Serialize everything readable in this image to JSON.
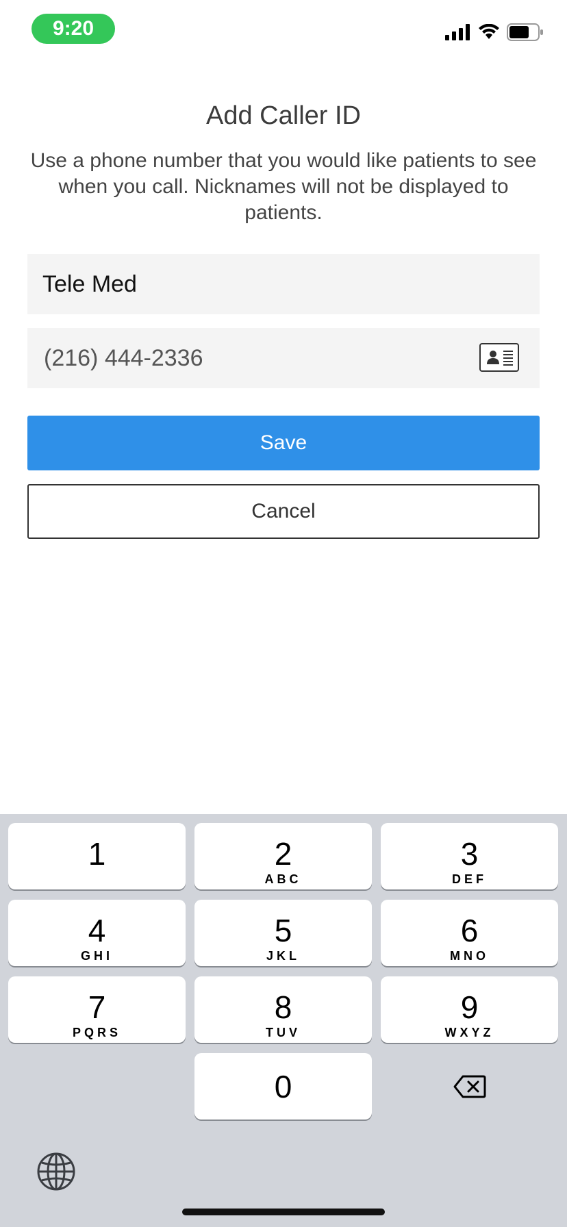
{
  "status_bar": {
    "time": "9:20",
    "icons": [
      "signal-icon",
      "wifi-icon",
      "battery-icon"
    ]
  },
  "form": {
    "title": "Add Caller ID",
    "description": "Use a phone number that you would like patients to see when you call. Nicknames will not be displayed to patients.",
    "nickname_value": "Tele Med",
    "phone_value": "(216) 444-2336",
    "contact_icon": "contact-card-icon",
    "save_label": "Save",
    "cancel_label": "Cancel"
  },
  "colors": {
    "primary": "#2f90e8",
    "status_green": "#34c759",
    "field_bg": "#f4f4f4",
    "keyboard_bg": "#d1d4da"
  },
  "keypad": {
    "keys": [
      {
        "num": "1",
        "letters": ""
      },
      {
        "num": "2",
        "letters": "ABC"
      },
      {
        "num": "3",
        "letters": "DEF"
      },
      {
        "num": "4",
        "letters": "GHI"
      },
      {
        "num": "5",
        "letters": "JKL"
      },
      {
        "num": "6",
        "letters": "MNO"
      },
      {
        "num": "7",
        "letters": "PQRS"
      },
      {
        "num": "8",
        "letters": "TUV"
      },
      {
        "num": "9",
        "letters": "WXYZ"
      },
      {
        "num": "0",
        "letters": ""
      }
    ],
    "delete_icon": "backspace-icon",
    "globe_icon": "globe-icon"
  }
}
